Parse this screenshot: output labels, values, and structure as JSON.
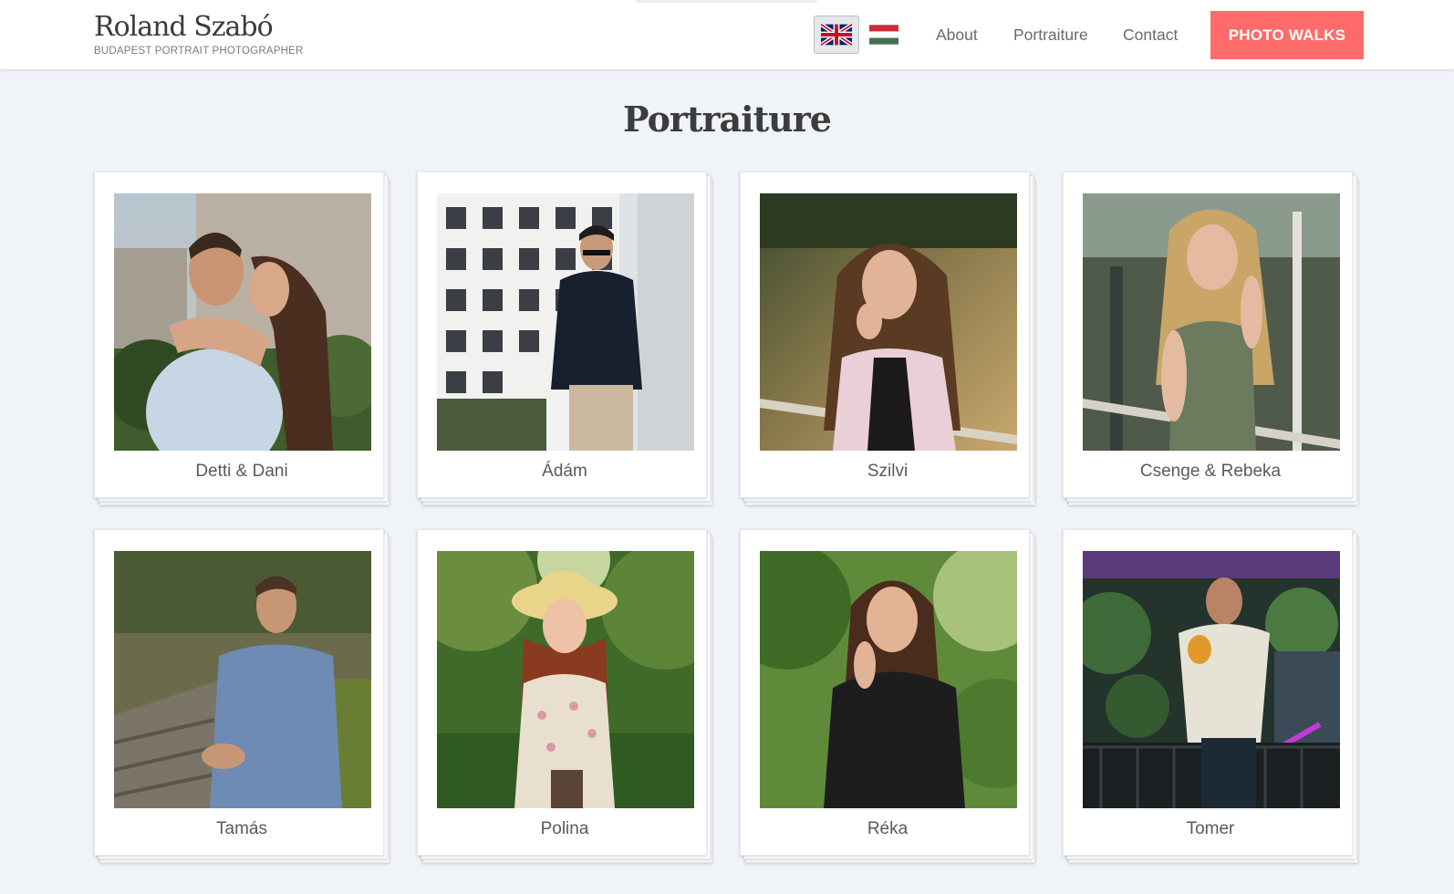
{
  "header": {
    "brand_name": "Roland Szabó",
    "brand_tagline": "BUDAPEST PORTRAIT PHOTOGRAPHER",
    "languages": [
      {
        "code": "en",
        "icon": "uk-flag-icon",
        "active": true
      },
      {
        "code": "hu",
        "icon": "hungary-flag-icon",
        "active": false
      }
    ],
    "nav": [
      "About",
      "Portraiture",
      "Contact"
    ],
    "cta_label": "PHOTO WALKS"
  },
  "page": {
    "title": "Portraiture"
  },
  "gallery": [
    {
      "name": "Detti & Dani"
    },
    {
      "name": "Ádám"
    },
    {
      "name": "Szilvi"
    },
    {
      "name": "Csenge & Rebeka"
    },
    {
      "name": "Tamás"
    },
    {
      "name": "Polina"
    },
    {
      "name": "Réka"
    },
    {
      "name": "Tomer"
    }
  ],
  "colors": {
    "accent": "#ff6b6b",
    "background": "#f0f3f7",
    "card": "#ffffff"
  }
}
